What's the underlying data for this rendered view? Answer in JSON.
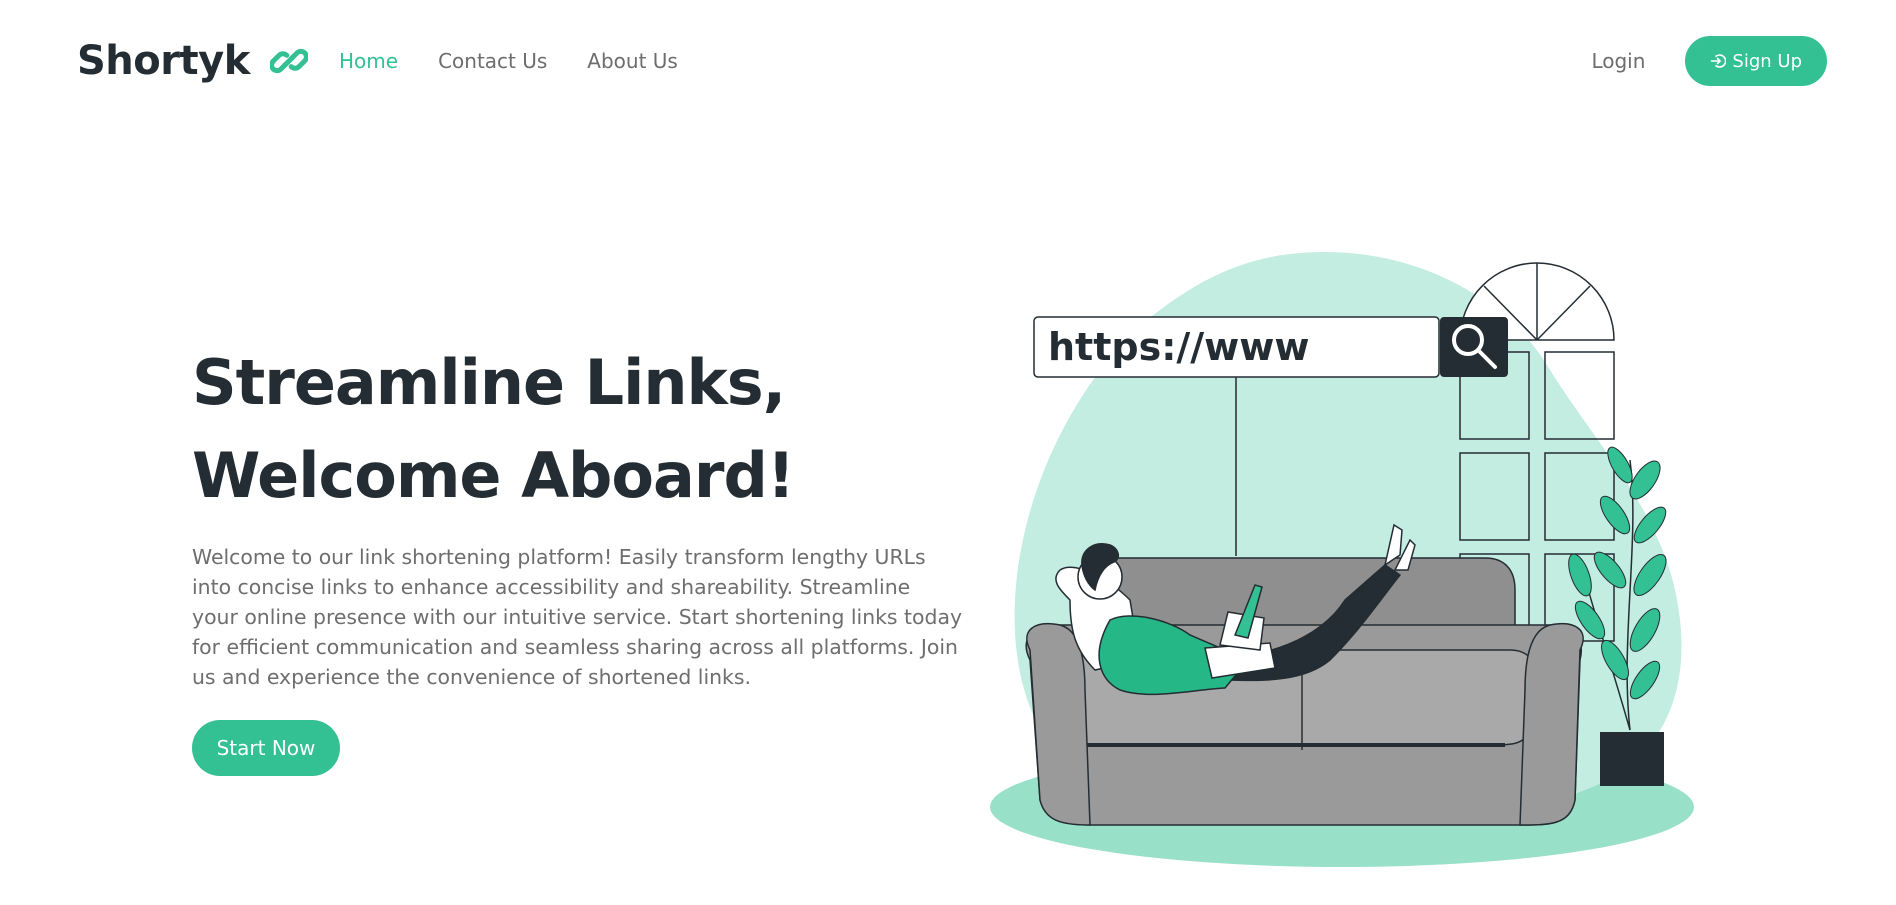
{
  "brand": {
    "name": "Shortyk",
    "icon": "link-icon",
    "accent_color": "#33c093",
    "dark_color": "#242d33"
  },
  "nav": {
    "items": [
      {
        "label": "Home",
        "active": true
      },
      {
        "label": "Contact Us",
        "active": false
      },
      {
        "label": "About Us",
        "active": false
      }
    ]
  },
  "auth": {
    "login_label": "Login",
    "signup_label": "Sign Up",
    "signup_icon": "sign-in-icon"
  },
  "hero": {
    "title_line1": "Streamline Links,",
    "title_line2": "Welcome Aboard!",
    "description": "Welcome to our link shortening platform! Easily transform lengthy URLs into concise links to enhance accessibility and shareability. Streamline your online presence with our intuitive service. Start shortening links today for efficient communication and seamless sharing across all platforms. Join us and experience the convenience of shortened links.",
    "cta_label": "Start Now"
  },
  "illustration": {
    "url_text": "https://www",
    "search_icon": "search-icon",
    "blob_color": "#c2ede0",
    "floor_color": "#99e0c8",
    "sofa_color": "#9a9a9a"
  }
}
